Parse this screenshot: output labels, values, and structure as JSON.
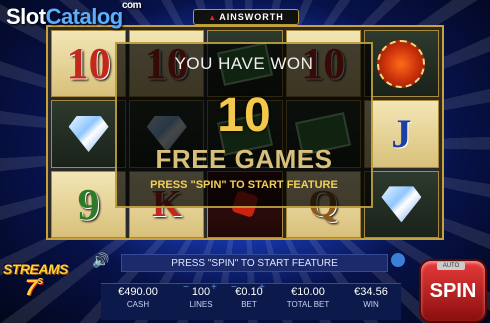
{
  "watermark": {
    "text1": "Slot",
    "text2": "Catalog",
    "suffix": "com"
  },
  "brand": {
    "name": "AINSWORTH"
  },
  "reels": [
    [
      "10",
      "diamond",
      "9"
    ],
    [
      "10",
      "diamond",
      "K"
    ],
    [
      "money",
      "money",
      "dice"
    ],
    [
      "10",
      "money",
      "Q"
    ],
    [
      "chip",
      "J",
      "diamond"
    ]
  ],
  "overlay": {
    "title": "YOU HAVE WON",
    "count": "10",
    "label": "FREE GAMES",
    "instruction": "PRESS \"SPIN\" TO START FEATURE"
  },
  "game_logo": {
    "line1": "STREAMS",
    "line2": "7",
    "superscript": "s"
  },
  "message_bar": "PRESS \"SPIN\" TO START FEATURE",
  "stats": {
    "cash_value": "€490.00",
    "cash_label": "CASH",
    "lines_value": "100",
    "lines_label": "LINES",
    "bet_value": "€0.10",
    "bet_label": "BET",
    "total_bet_value": "€10.00",
    "total_bet_label": "TOTAL BET",
    "win_value": "€34.56",
    "win_label": "WIN"
  },
  "controls": {
    "spin_label": "SPIN",
    "auto_label": "AUTO"
  },
  "colors": {
    "accent_gold": "#f4c84a",
    "spin_red": "#e83a3a",
    "panel_navy": "#0b1a4a"
  }
}
